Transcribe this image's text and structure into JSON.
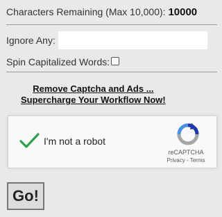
{
  "chars": {
    "label": "Characters Remaining (Max 10,000):",
    "count": "10000"
  },
  "ignore": {
    "label": "Ignore Any:",
    "value": ""
  },
  "spin": {
    "label": "Spin Capitalized Words:",
    "checked": false
  },
  "promo": {
    "line1": "Remove Captcha and Ads ...",
    "line2": "Supercharge Your Workflow Now!"
  },
  "captcha": {
    "label": "I'm not a robot",
    "brand": "reCAPTCHA",
    "terms": "Privacy - Terms",
    "check_color": "#2e9e4f",
    "verified": true
  },
  "go": {
    "label": "Go!"
  }
}
